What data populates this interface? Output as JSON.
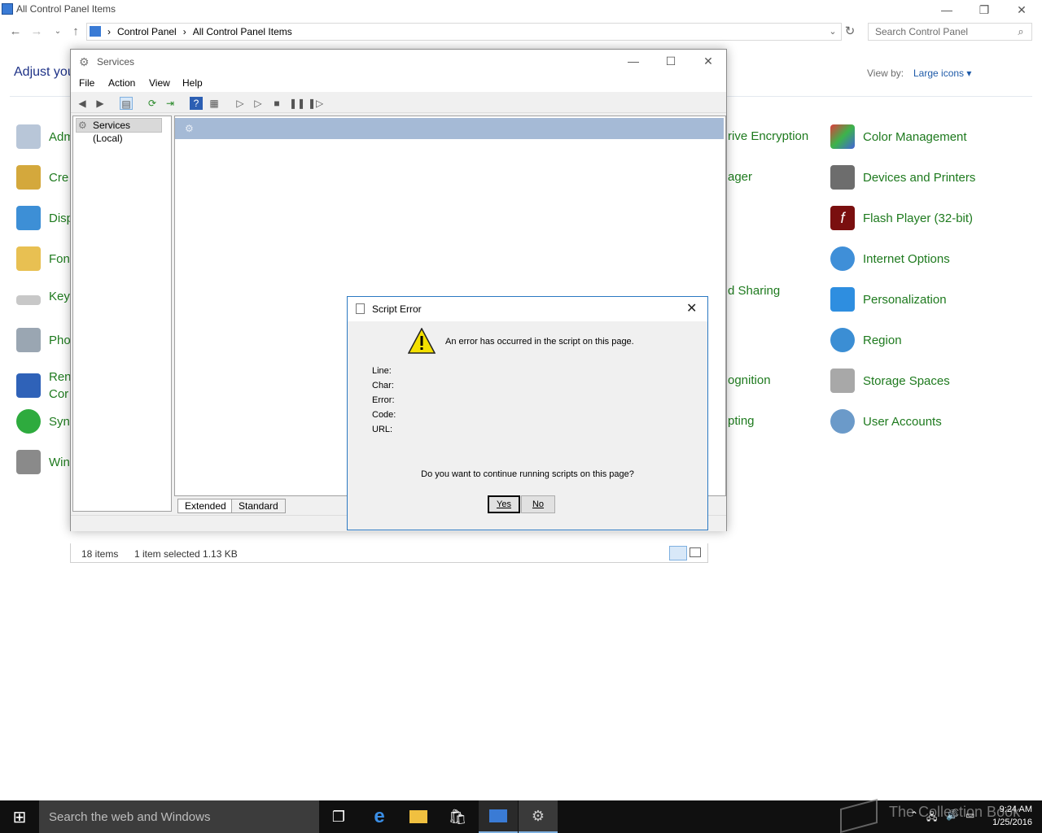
{
  "control_panel": {
    "window_title": "All Control Panel Items",
    "breadcrumb": [
      "Control Panel",
      "All Control Panel Items"
    ],
    "search_placeholder": "Search Control Panel",
    "heading_partial": "Adjust you",
    "view_by_label": "View by:",
    "view_by_value": "Large icons",
    "left_items": [
      "Adm",
      "Cre",
      "Disp",
      "Fon",
      "Key",
      "Pho",
      "Ren",
      "Cor",
      "Syn",
      "Win"
    ],
    "middle_items": [
      "rive Encryption",
      "ager",
      "d Sharing",
      "ognition",
      "pting"
    ],
    "right_items": [
      "Color Management",
      "Devices and Printers",
      "Flash Player (32-bit)",
      "Internet Options",
      "Personalization",
      "Region",
      "Storage Spaces",
      "User Accounts"
    ],
    "status_items": "18 items",
    "status_selected": "1 item selected  1.13 KB"
  },
  "services": {
    "title": "Services",
    "menu": [
      "File",
      "Action",
      "View",
      "Help"
    ],
    "tree_item": "Services (Local)",
    "tabs": [
      "Extended",
      "Standard"
    ]
  },
  "dialog": {
    "title": "Script Error",
    "message": "An error has occurred in the script on this page.",
    "fields": [
      "Line:",
      "Char:",
      "Error:",
      "Code:",
      "URL:"
    ],
    "question": "Do you want to continue running scripts on this page?",
    "yes": "Yes",
    "no": "No"
  },
  "taskbar": {
    "search_text": "Search the web and Windows",
    "time": "9:24 AM",
    "date": "1/25/2016",
    "watermark": "The Collection Book"
  },
  "colors": {
    "link_green": "#1e7a1e",
    "accent_blue": "#2b79c2",
    "banner": "#a5bad6"
  }
}
